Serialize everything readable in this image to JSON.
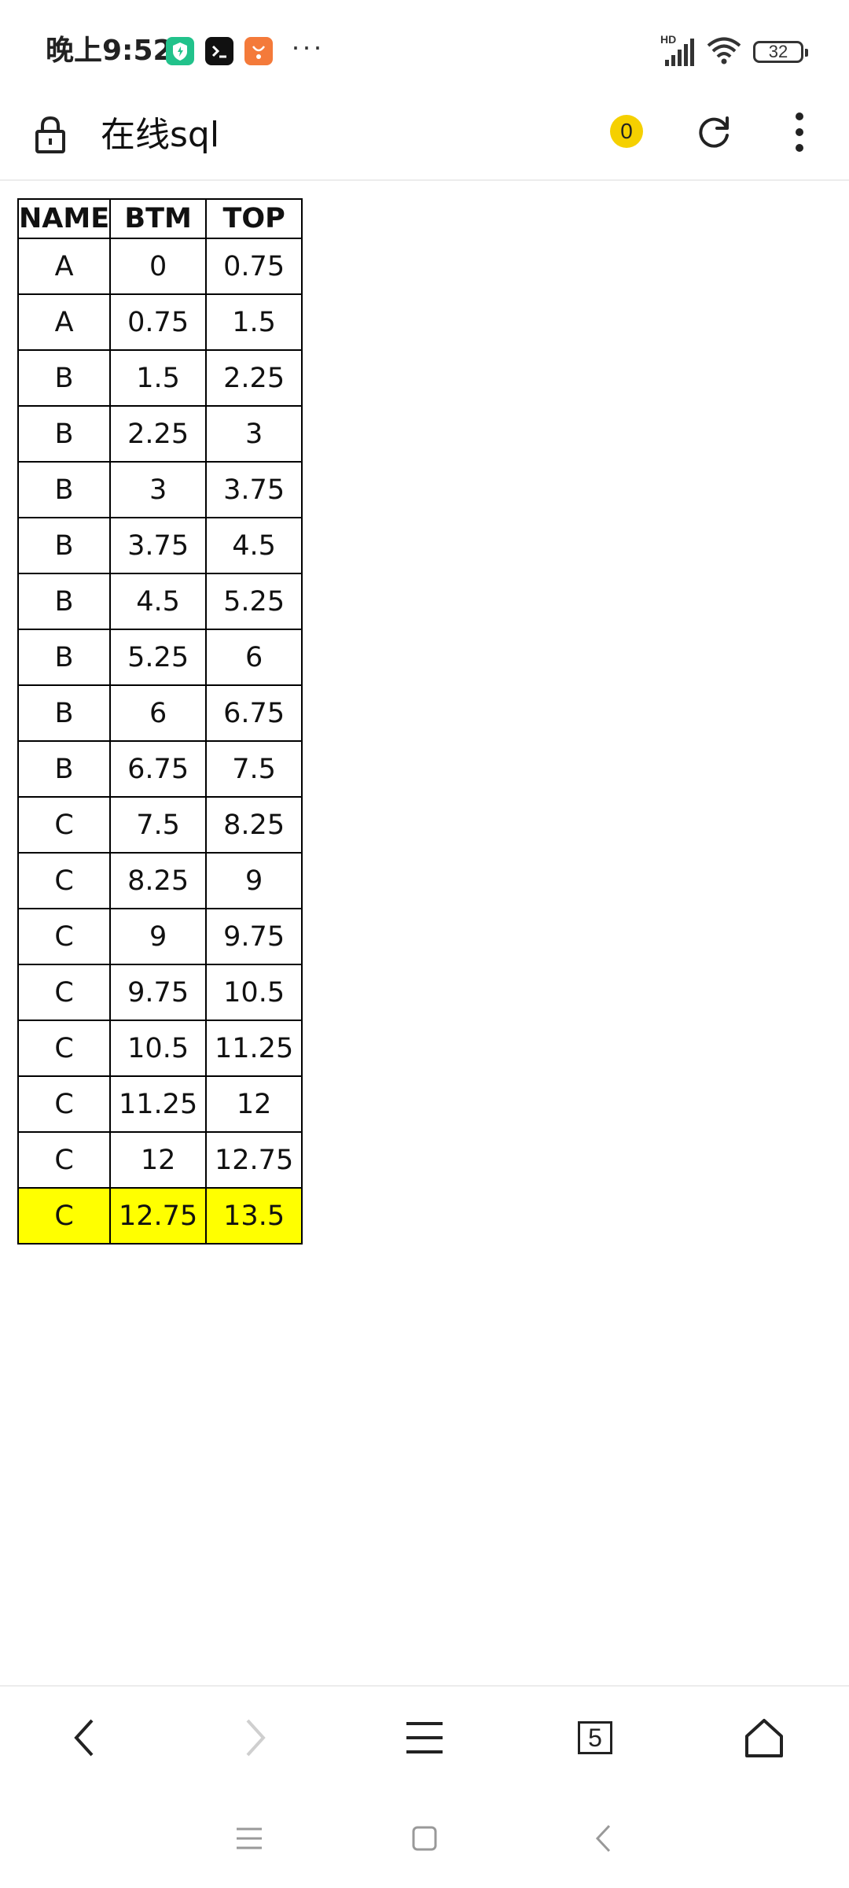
{
  "status_bar": {
    "time": "晚上9:52",
    "more": "···",
    "network_label": "HD",
    "battery": "32"
  },
  "browser": {
    "page_title": "在线sql",
    "tab_badge": "0",
    "tab_count": "5"
  },
  "table": {
    "headers": [
      "NAME",
      "BTM",
      "TOP"
    ],
    "rows": [
      [
        "A",
        "0",
        "0.75"
      ],
      [
        "A",
        "0.75",
        "1.5"
      ],
      [
        "B",
        "1.5",
        "2.25"
      ],
      [
        "B",
        "2.25",
        "3"
      ],
      [
        "B",
        "3",
        "3.75"
      ],
      [
        "B",
        "3.75",
        "4.5"
      ],
      [
        "B",
        "4.5",
        "5.25"
      ],
      [
        "B",
        "5.25",
        "6"
      ],
      [
        "B",
        "6",
        "6.75"
      ],
      [
        "B",
        "6.75",
        "7.5"
      ],
      [
        "C",
        "7.5",
        "8.25"
      ],
      [
        "C",
        "8.25",
        "9"
      ],
      [
        "C",
        "9",
        "9.75"
      ],
      [
        "C",
        "9.75",
        "10.5"
      ],
      [
        "C",
        "10.5",
        "11.25"
      ],
      [
        "C",
        "11.25",
        "12"
      ],
      [
        "C",
        "12",
        "12.75"
      ],
      [
        "C",
        "12.75",
        "13.5"
      ]
    ],
    "highlight_row_index": 17,
    "highlight_color": "#ffff00"
  },
  "colors": {
    "accent_badge": "#f5d000",
    "text": "#111111"
  },
  "icons": {
    "top_bar": [
      "lock-icon",
      "refresh-icon",
      "more-vertical-icon"
    ],
    "bottom_nav": [
      "back-icon",
      "forward-icon",
      "menu-icon",
      "tabs-icon",
      "home-icon"
    ],
    "system_nav": [
      "recent-apps-icon",
      "home-square-icon",
      "back-triangle-icon"
    ]
  }
}
